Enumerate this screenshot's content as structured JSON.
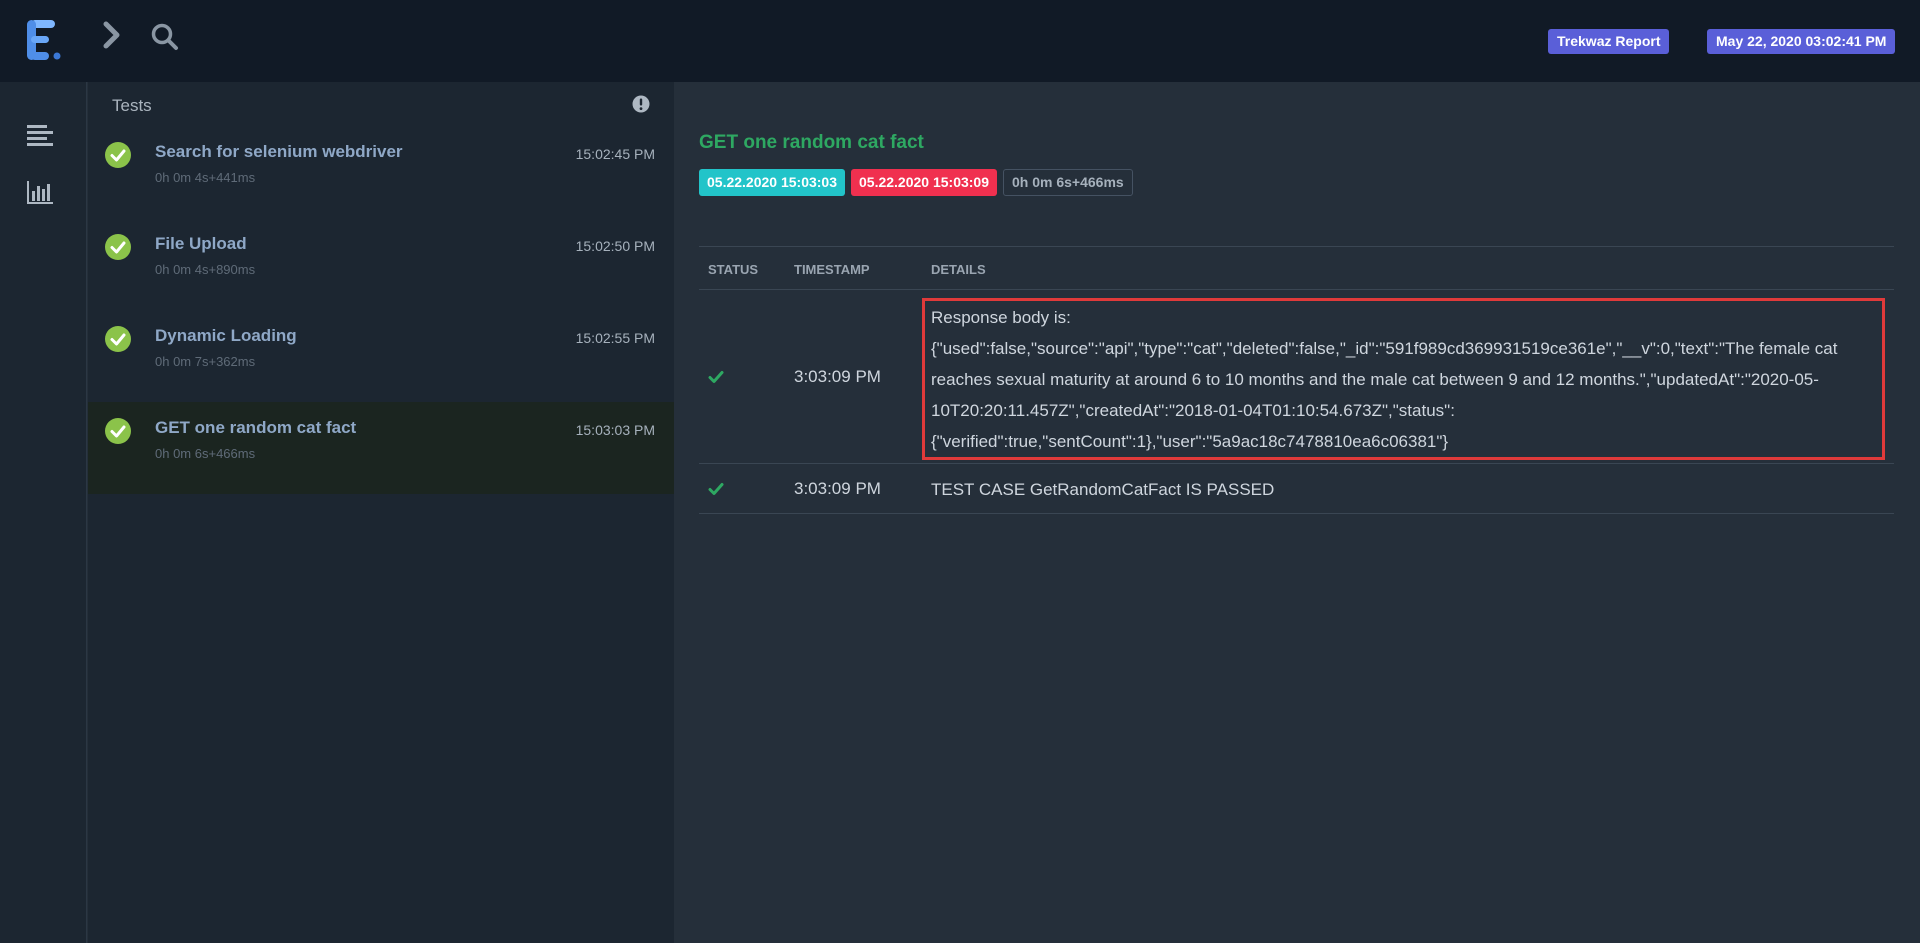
{
  "header": {
    "report_badge": "Trekwaz Report",
    "date_badge": "May 22, 2020 03:02:41 PM",
    "icons": [
      "logo-icon",
      "chevron-right-icon",
      "search-icon"
    ]
  },
  "sidenav": {
    "icons": [
      "list-view-icon",
      "dashboard-chart-icon"
    ]
  },
  "test_list": {
    "title": "Tests",
    "items": [
      {
        "name": "Search for selenium webdriver",
        "duration": "0h 0m 4s+441ms",
        "time": "15:02:45 PM",
        "status": "pass"
      },
      {
        "name": "File Upload",
        "duration": "0h 0m 4s+890ms",
        "time": "15:02:50 PM",
        "status": "pass"
      },
      {
        "name": "Dynamic Loading",
        "duration": "0h 0m 7s+362ms",
        "time": "15:02:55 PM",
        "status": "pass"
      },
      {
        "name": "GET one random cat fact",
        "duration": "0h 0m 6s+466ms",
        "time": "15:03:03 PM",
        "status": "pass"
      }
    ]
  },
  "detail": {
    "title": "GET one random cat fact",
    "start": "05.22.2020 15:03:03",
    "end": "05.22.2020 15:03:09",
    "duration": "0h 0m 6s+466ms",
    "columns": [
      "STATUS",
      "TIMESTAMP",
      "DETAILS"
    ],
    "logs": [
      {
        "status": "pass",
        "timestamp": "3:03:09 PM",
        "details_lines": [
          "Response body is:",
          "{\"used\":false,\"source\":\"api\",\"type\":\"cat\",\"deleted\":false,\"_id\":\"591f989cd369931519ce361e\",\"__v\":0,\"text\":\"The female cat",
          "reaches sexual maturity at around 6 to 10 months and the male cat between 9 and 12 months.\",\"updatedAt\":\"2020-05-",
          "10T20:20:11.457Z\",\"createdAt\":\"2018-01-04T01:10:54.673Z\",\"status\":",
          "{\"verified\":true,\"sentCount\":1},\"user\":\"5a9ac18c7478810ea6c06381\"}"
        ]
      },
      {
        "status": "pass",
        "timestamp": "3:03:09 PM",
        "details_lines": [
          "TEST CASE GetRandomCatFact IS PASSED"
        ]
      }
    ]
  },
  "colors": {
    "accent_green": "#2ea862",
    "badge_purple": "#5a5fd8",
    "pass_check": "#8bc34a",
    "start_cyan": "#22c4c9",
    "end_red": "#f0304f",
    "highlight_red": "#e03a3a"
  }
}
